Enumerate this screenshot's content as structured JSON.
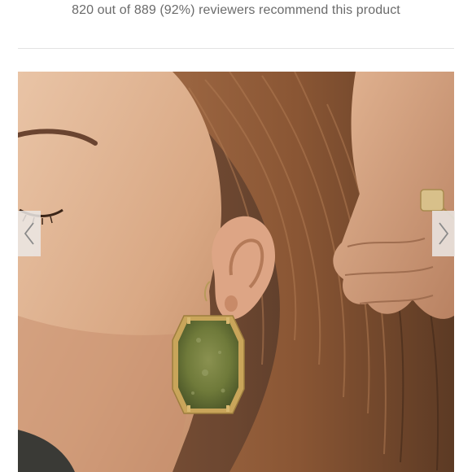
{
  "reviews": {
    "recommend_text": "820 out of 889 (92%) reviewers recommend this product"
  },
  "gallery": {
    "image_subject": "earring-model-photo",
    "prev_icon": "chevron-left-icon",
    "next_icon": "chevron-right-icon"
  },
  "colors": {
    "text_muted": "#6b6b6b",
    "divider": "#e3e3e3",
    "arrow_bg": "#ebe8e5",
    "stone": "#6f7a3a",
    "gold": "#c9a55a"
  }
}
